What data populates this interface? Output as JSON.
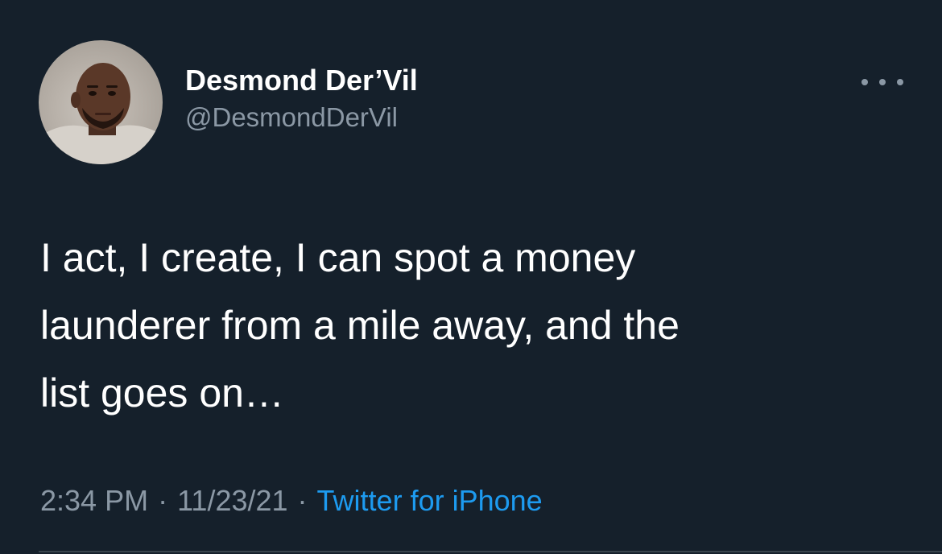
{
  "tweet": {
    "author": {
      "display_name": "Desmond Der’Vil",
      "handle": "@DesmondDerVil",
      "avatar_icon": "profile-photo"
    },
    "more_icon": "more-horizontal-icon",
    "text": "I act, I create, I can spot a money\nlaunderer from a mile away, and the\nlist goes on…",
    "time": "2:34 PM",
    "separator": "·",
    "date": "11/23/21",
    "source": "Twitter for iPhone"
  },
  "colors": {
    "background": "#15202b",
    "primary_text": "#ffffff",
    "secondary_text": "#8b98a5",
    "link": "#1d9bf0",
    "divider": "#38444d"
  }
}
